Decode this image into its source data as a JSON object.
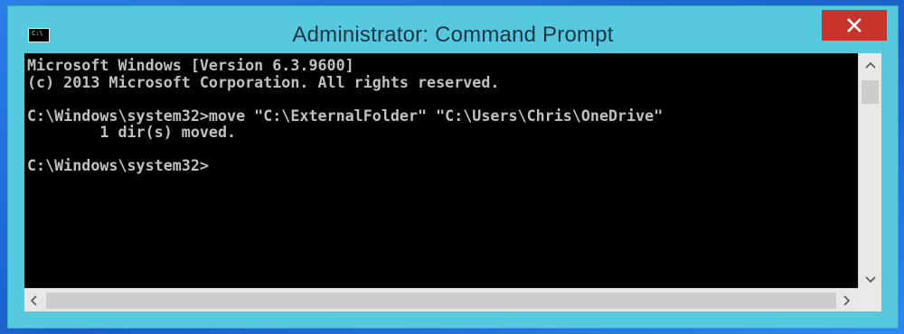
{
  "window": {
    "title": "Administrator: Command Prompt",
    "icon": "cmd-icon",
    "icon_label": "C:\\"
  },
  "console": {
    "lines": [
      "Microsoft Windows [Version 6.3.9600]",
      "(c) 2013 Microsoft Corporation. All rights reserved.",
      "",
      "C:\\Windows\\system32>move \"C:\\ExternalFolder\" \"C:\\Users\\Chris\\OneDrive\"",
      "        1 dir(s) moved.",
      "",
      "C:\\Windows\\system32>"
    ]
  },
  "colors": {
    "titlebar": "#57c9df",
    "close_button": "#c7342b",
    "console_bg": "#000000",
    "console_text": "#c0c0c0"
  }
}
